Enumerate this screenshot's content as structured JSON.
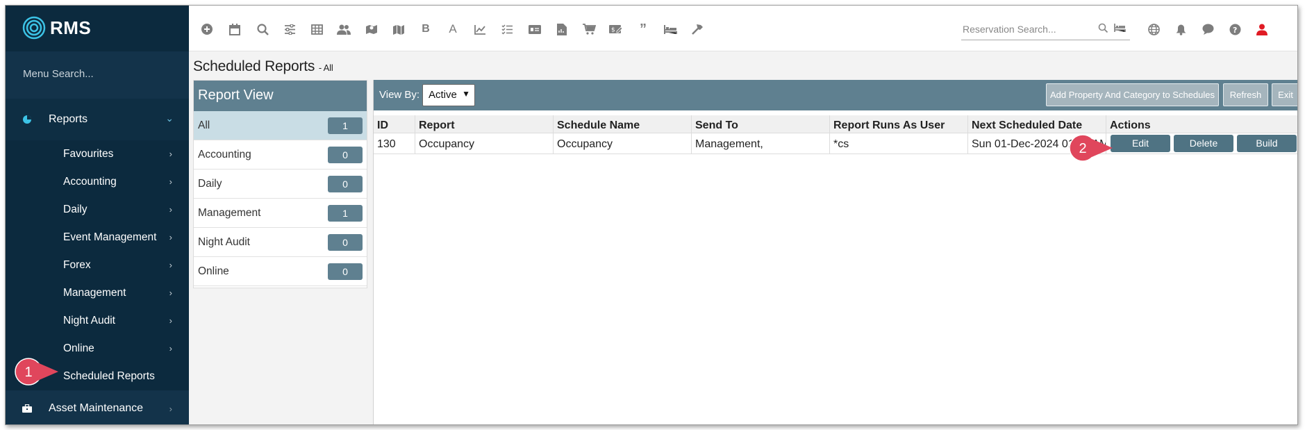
{
  "app": {
    "logo_text": "RMS"
  },
  "sidebar": {
    "menu_search": "Menu Search...",
    "reports_label": "Reports",
    "items": [
      {
        "label": "Favourites"
      },
      {
        "label": "Accounting"
      },
      {
        "label": "Daily"
      },
      {
        "label": "Event Management"
      },
      {
        "label": "Forex"
      },
      {
        "label": "Management"
      },
      {
        "label": "Night Audit"
      },
      {
        "label": "Online"
      },
      {
        "label": "Scheduled Reports"
      }
    ],
    "asset_label": "Asset Maintenance"
  },
  "topbar": {
    "icons": [
      "plus-circle-icon",
      "calendar-icon",
      "search-icon",
      "sliders-icon",
      "grid-icon",
      "users-icon",
      "map-pin-icon",
      "map-icon",
      "bold-b-icon",
      "letter-a-icon",
      "chart-line-icon",
      "checklist-icon",
      "card-icon",
      "document-icon",
      "cart-icon",
      "money-icon",
      "quote-icon",
      "bed-icon",
      "hammer-icon"
    ],
    "reservation_search_placeholder": "Reservation Search...",
    "right_icons": [
      "globe-icon",
      "bell-icon",
      "chat-icon",
      "help-icon",
      "user-icon"
    ]
  },
  "page": {
    "title": "Scheduled Reports",
    "subtitle": "- All"
  },
  "report_view": {
    "title": "Report View",
    "items": [
      {
        "label": "All",
        "count": "1"
      },
      {
        "label": "Accounting",
        "count": "0"
      },
      {
        "label": "Daily",
        "count": "0"
      },
      {
        "label": "Management",
        "count": "1"
      },
      {
        "label": "Night Audit",
        "count": "0"
      },
      {
        "label": "Online",
        "count": "0"
      }
    ]
  },
  "toolbar": {
    "view_by_label": "View By:",
    "view_by_value": "Active",
    "add_button": "Add Property And Category to Schedules",
    "refresh_button": "Refresh",
    "exit_button": "Exit"
  },
  "table": {
    "headers": [
      "ID",
      "Report",
      "Schedule Name",
      "Send To",
      "Report Runs As User",
      "Next Scheduled Date",
      "Actions"
    ],
    "rows": [
      {
        "id": "130",
        "report": "Occupancy",
        "schedule_name": "Occupancy",
        "send_to": "Management,",
        "runs_as": "*cs",
        "next_date": "Sun 01-Dec-2024 01:00 AM"
      }
    ],
    "actions": {
      "edit": "Edit",
      "delete": "Delete",
      "build": "Build"
    }
  },
  "callouts": {
    "one": "1",
    "two": "2"
  },
  "colors": {
    "sidebar": "#0c2a3e",
    "accent": "#5f8090",
    "callout": "#e0465c",
    "action": "#4f7383"
  }
}
